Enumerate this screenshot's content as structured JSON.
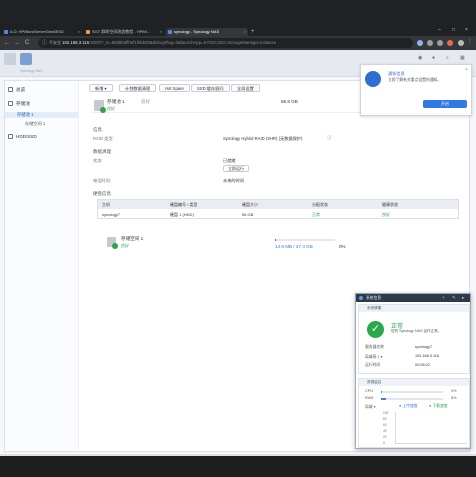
{
  "browser": {
    "tabs": [
      {
        "label": "ILO: HPMicroServerGen8ESD",
        "active": false
      },
      {
        "label": "SGT 群晖空间改造教程 - HPMi...",
        "active": false
      },
      {
        "label": "synology - Synology NAS",
        "active": true
      }
    ],
    "new_tab": "+",
    "secure_label": "不安全",
    "url_host": "192.168.3.116",
    "url_rest": ":5000/?_tc=88d6b9ff0ef1f6bb20&debugFlag=0&launchApp=SYNO.SDS.StorageManager.Instance",
    "back": "←",
    "forward": "→",
    "reload": "C"
  },
  "dsm": {
    "top_sub": "Synology NAS",
    "accent": "#2f7ae5"
  },
  "sidebar": {
    "items": [
      {
        "label": "总览"
      },
      {
        "label": "存储池"
      },
      {
        "label": "HDD/SSD"
      }
    ],
    "pool_sub": "存储池 1",
    "volume_sub": "存储空间 1"
  },
  "toolbar": {
    "buttons": [
      "新增 ▾",
      "计划数据清理",
      "Hot Spare",
      "SSD 缓存顾问",
      "全局设置"
    ]
  },
  "pool": {
    "name": "存储池 1",
    "status_hint": "良好",
    "size": "56.8 GB",
    "status": "良好",
    "info_title": "信息",
    "raid_label": "RAID 类型:",
    "raid_value": "Synology Hybrid RAID (SHR) (无数据保护)",
    "scrub_title": "数据清理",
    "scrub_label": "状态:",
    "scrub_value": "已就绪",
    "scrub_button": "立即运行",
    "last_label": "电话时间:",
    "last_value": "未来的时间",
    "disks_title": "硬盘信息"
  },
  "disk_table": {
    "headers": [
      "主机",
      "硬盘编号 / 类型",
      "硬盘大小",
      "分配状态",
      "健康状态"
    ],
    "rows": [
      [
        "synology7",
        "硬盘 1 (HDD)",
        "56 GB",
        "正常",
        "良好"
      ]
    ]
  },
  "volume": {
    "name": "存储空间 1",
    "status": "良好",
    "usage": "14.9 MB / 37.4 GB",
    "percent": "0%",
    "fraction": 0.004
  },
  "notification": {
    "title": "通知信息",
    "message": "立即了解有关重点设置的通知。",
    "button": "开启",
    "close": "×"
  },
  "widget": {
    "header": "系统信息",
    "health_title": "系统健康",
    "status": "正常",
    "status_desc": "您的 Synology NAS 运作正常。",
    "rows": [
      {
        "k": "服务器名称",
        "v": "synology7"
      },
      {
        "k": "局域网 1 ▾",
        "v": "192.168.3.116"
      },
      {
        "k": "运行时间",
        "v": "00:08:02"
      }
    ],
    "monitor_title": "资源监控",
    "cpu_label": "CPU",
    "cpu_pct": "0%",
    "cpu_fraction": 0.02,
    "ram_label": "RAM",
    "ram_pct": "8%",
    "ram_fraction": 0.08,
    "net_label": "局域 ▾",
    "legend_up": "● 上传速度",
    "legend_down": "● 下载速度",
    "y_ticks": [
      "100",
      "80",
      "60",
      "40",
      "20",
      "0"
    ]
  }
}
